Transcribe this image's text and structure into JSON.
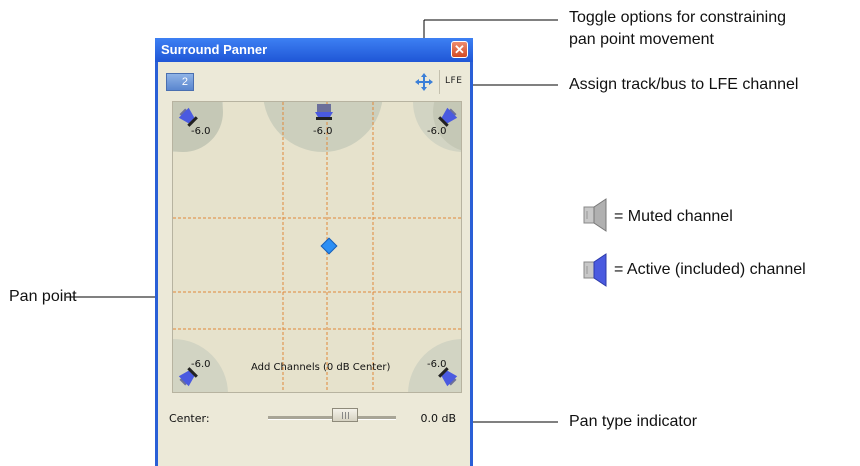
{
  "window": {
    "title": "Surround Panner",
    "close_glyph": "✕",
    "channel_button": "2",
    "lfe_button": "LFE"
  },
  "pan_pad": {
    "speakers": {
      "front_left": "-6.0",
      "center": "-6.0",
      "front_right": "-6.0",
      "rear_left": "-6.0",
      "rear_right": "-6.0"
    },
    "pan_type": "Add Channels (0 dB Center)"
  },
  "center_fader": {
    "label": "Center:",
    "value": "0.0 dB",
    "position": 0.6
  },
  "callouts": {
    "constrain": [
      "Toggle options for constraining",
      "pan point movement"
    ],
    "lfe": "Assign track/bus to LFE channel",
    "muted": "= Muted channel",
    "active": "= Active (included) channel",
    "pan_point": "Pan point",
    "pan_type": "Pan type indicator"
  },
  "colors": {
    "title_bar": "#2a5fd6",
    "pan_point": "#2b8ff5",
    "guide_lines": "#e0883a",
    "speaker_active": "#4a5ae0",
    "speaker_muted": "#b0b0b0"
  },
  "icons": [
    "move-constrain-icon",
    "close-icon",
    "speaker-icon"
  ]
}
